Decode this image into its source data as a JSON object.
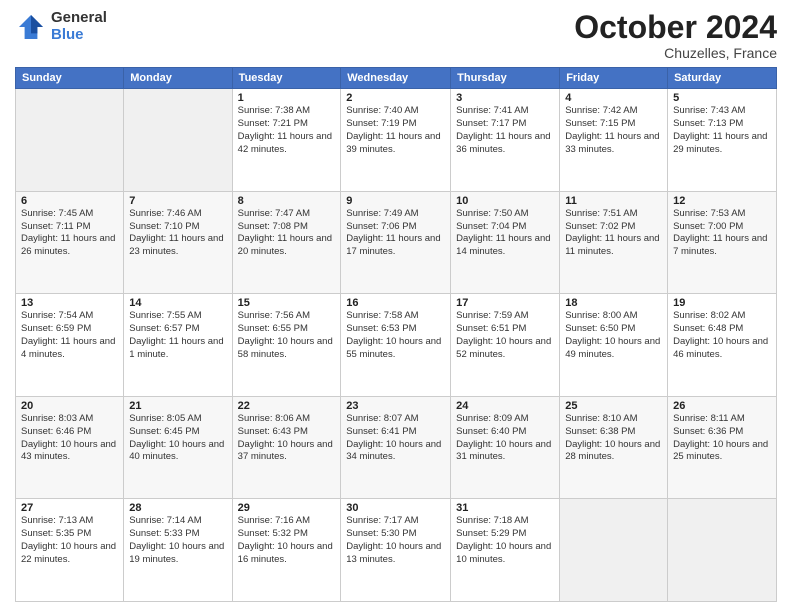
{
  "header": {
    "logo_general": "General",
    "logo_blue": "Blue",
    "month": "October 2024",
    "location": "Chuzelles, France"
  },
  "days_of_week": [
    "Sunday",
    "Monday",
    "Tuesday",
    "Wednesday",
    "Thursday",
    "Friday",
    "Saturday"
  ],
  "weeks": [
    [
      {
        "day": "",
        "info": ""
      },
      {
        "day": "",
        "info": ""
      },
      {
        "day": "1",
        "info": "Sunrise: 7:38 AM\nSunset: 7:21 PM\nDaylight: 11 hours and 42 minutes."
      },
      {
        "day": "2",
        "info": "Sunrise: 7:40 AM\nSunset: 7:19 PM\nDaylight: 11 hours and 39 minutes."
      },
      {
        "day": "3",
        "info": "Sunrise: 7:41 AM\nSunset: 7:17 PM\nDaylight: 11 hours and 36 minutes."
      },
      {
        "day": "4",
        "info": "Sunrise: 7:42 AM\nSunset: 7:15 PM\nDaylight: 11 hours and 33 minutes."
      },
      {
        "day": "5",
        "info": "Sunrise: 7:43 AM\nSunset: 7:13 PM\nDaylight: 11 hours and 29 minutes."
      }
    ],
    [
      {
        "day": "6",
        "info": "Sunrise: 7:45 AM\nSunset: 7:11 PM\nDaylight: 11 hours and 26 minutes."
      },
      {
        "day": "7",
        "info": "Sunrise: 7:46 AM\nSunset: 7:10 PM\nDaylight: 11 hours and 23 minutes."
      },
      {
        "day": "8",
        "info": "Sunrise: 7:47 AM\nSunset: 7:08 PM\nDaylight: 11 hours and 20 minutes."
      },
      {
        "day": "9",
        "info": "Sunrise: 7:49 AM\nSunset: 7:06 PM\nDaylight: 11 hours and 17 minutes."
      },
      {
        "day": "10",
        "info": "Sunrise: 7:50 AM\nSunset: 7:04 PM\nDaylight: 11 hours and 14 minutes."
      },
      {
        "day": "11",
        "info": "Sunrise: 7:51 AM\nSunset: 7:02 PM\nDaylight: 11 hours and 11 minutes."
      },
      {
        "day": "12",
        "info": "Sunrise: 7:53 AM\nSunset: 7:00 PM\nDaylight: 11 hours and 7 minutes."
      }
    ],
    [
      {
        "day": "13",
        "info": "Sunrise: 7:54 AM\nSunset: 6:59 PM\nDaylight: 11 hours and 4 minutes."
      },
      {
        "day": "14",
        "info": "Sunrise: 7:55 AM\nSunset: 6:57 PM\nDaylight: 11 hours and 1 minute."
      },
      {
        "day": "15",
        "info": "Sunrise: 7:56 AM\nSunset: 6:55 PM\nDaylight: 10 hours and 58 minutes."
      },
      {
        "day": "16",
        "info": "Sunrise: 7:58 AM\nSunset: 6:53 PM\nDaylight: 10 hours and 55 minutes."
      },
      {
        "day": "17",
        "info": "Sunrise: 7:59 AM\nSunset: 6:51 PM\nDaylight: 10 hours and 52 minutes."
      },
      {
        "day": "18",
        "info": "Sunrise: 8:00 AM\nSunset: 6:50 PM\nDaylight: 10 hours and 49 minutes."
      },
      {
        "day": "19",
        "info": "Sunrise: 8:02 AM\nSunset: 6:48 PM\nDaylight: 10 hours and 46 minutes."
      }
    ],
    [
      {
        "day": "20",
        "info": "Sunrise: 8:03 AM\nSunset: 6:46 PM\nDaylight: 10 hours and 43 minutes."
      },
      {
        "day": "21",
        "info": "Sunrise: 8:05 AM\nSunset: 6:45 PM\nDaylight: 10 hours and 40 minutes."
      },
      {
        "day": "22",
        "info": "Sunrise: 8:06 AM\nSunset: 6:43 PM\nDaylight: 10 hours and 37 minutes."
      },
      {
        "day": "23",
        "info": "Sunrise: 8:07 AM\nSunset: 6:41 PM\nDaylight: 10 hours and 34 minutes."
      },
      {
        "day": "24",
        "info": "Sunrise: 8:09 AM\nSunset: 6:40 PM\nDaylight: 10 hours and 31 minutes."
      },
      {
        "day": "25",
        "info": "Sunrise: 8:10 AM\nSunset: 6:38 PM\nDaylight: 10 hours and 28 minutes."
      },
      {
        "day": "26",
        "info": "Sunrise: 8:11 AM\nSunset: 6:36 PM\nDaylight: 10 hours and 25 minutes."
      }
    ],
    [
      {
        "day": "27",
        "info": "Sunrise: 7:13 AM\nSunset: 5:35 PM\nDaylight: 10 hours and 22 minutes."
      },
      {
        "day": "28",
        "info": "Sunrise: 7:14 AM\nSunset: 5:33 PM\nDaylight: 10 hours and 19 minutes."
      },
      {
        "day": "29",
        "info": "Sunrise: 7:16 AM\nSunset: 5:32 PM\nDaylight: 10 hours and 16 minutes."
      },
      {
        "day": "30",
        "info": "Sunrise: 7:17 AM\nSunset: 5:30 PM\nDaylight: 10 hours and 13 minutes."
      },
      {
        "day": "31",
        "info": "Sunrise: 7:18 AM\nSunset: 5:29 PM\nDaylight: 10 hours and 10 minutes."
      },
      {
        "day": "",
        "info": ""
      },
      {
        "day": "",
        "info": ""
      }
    ]
  ]
}
